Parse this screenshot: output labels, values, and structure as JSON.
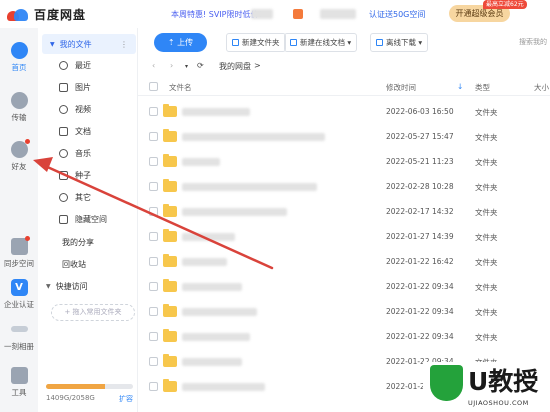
{
  "header": {
    "app_name": "百度网盘",
    "promo_text": "本周特惠! SVIP限时低价!",
    "cert_text": "认证送50G空间",
    "vip_button": "开通超级会员",
    "vip_tag": "最高立减62元"
  },
  "rail": {
    "items": [
      {
        "label": "首页",
        "icon": "cloud-home-icon",
        "active": true
      },
      {
        "label": "传输",
        "icon": "transfer-icon"
      },
      {
        "label": "好友",
        "icon": "friends-icon",
        "badge": true
      },
      {
        "label": "同步空间",
        "icon": "sync-space-icon",
        "badge": true
      },
      {
        "label": "企业认证",
        "icon": "enterprise-v-icon"
      },
      {
        "label": "一刻相册",
        "icon": "album-icon"
      },
      {
        "label": "工具",
        "icon": "tools-grid-icon"
      }
    ]
  },
  "nav": {
    "my_files": "我的文件",
    "more": "⋮",
    "categories": [
      {
        "label": "最近",
        "icon": "clock-icon"
      },
      {
        "label": "图片",
        "icon": "image-icon"
      },
      {
        "label": "视频",
        "icon": "video-play-icon"
      },
      {
        "label": "文档",
        "icon": "document-icon"
      },
      {
        "label": "音乐",
        "icon": "headphones-icon"
      },
      {
        "label": "种子",
        "icon": "torrent-icon"
      },
      {
        "label": "其它",
        "icon": "ellipsis-icon"
      },
      {
        "label": "隐藏空间",
        "icon": "lock-box-icon"
      }
    ],
    "my_share": "我的分享",
    "recycle": "回收站",
    "quick_access": "快捷访问",
    "quick_add": "+ 拖入常用文件夹",
    "storage_text": "1409G/2058G",
    "storage_used_fraction": 0.68,
    "expand": "扩容"
  },
  "toolbar": {
    "upload": "上传",
    "new_folder": "新建文件夹",
    "new_online_doc": "新建在线文档 ▾",
    "offline_download": "离线下载 ▾",
    "search_placeholder": "搜索我的"
  },
  "path": {
    "back": "‹",
    "forward": "›",
    "history": "▾",
    "refresh": "⟳",
    "current": "我的网盘",
    "sep": ">"
  },
  "table": {
    "col_name": "文件名",
    "col_modified": "修改时间",
    "sort_arrow": "↓",
    "col_type": "类型",
    "col_size": "大小",
    "rows": [
      {
        "date": "2022-06-03 16:50",
        "type": "文件夹",
        "name_width": 0.45
      },
      {
        "date": "2022-05-27 15:47",
        "type": "文件夹",
        "name_width": 0.95
      },
      {
        "date": "2022-05-21 11:23",
        "type": "文件夹",
        "name_width": 0.25
      },
      {
        "date": "2022-02-28 10:28",
        "type": "文件夹",
        "name_width": 0.9
      },
      {
        "date": "2022-02-17 14:32",
        "type": "文件夹",
        "name_width": 0.7
      },
      {
        "date": "2022-01-27 14:39",
        "type": "文件夹",
        "name_width": 0.35
      },
      {
        "date": "2022-01-22 16:42",
        "type": "文件夹",
        "name_width": 0.3
      },
      {
        "date": "2022-01-22 09:34",
        "type": "文件夹",
        "name_width": 0.4
      },
      {
        "date": "2022-01-22 09:34",
        "type": "文件夹",
        "name_width": 0.5
      },
      {
        "date": "2022-01-22 09:34",
        "type": "文件夹",
        "name_width": 0.45
      },
      {
        "date": "2022-01-22 09:34",
        "type": "文件夹",
        "name_width": 0.4
      },
      {
        "date": "2022-01-22 09:34",
        "type": "文件夹",
        "name_width": 0.55
      }
    ]
  },
  "watermark": {
    "brand": "U教授",
    "url": "UJIAOSHOU.COM"
  },
  "colors": {
    "accent": "#2f86f6",
    "folder": "#f7c74c",
    "arrow": "#d9433b",
    "vip": "#f7d6a0"
  }
}
